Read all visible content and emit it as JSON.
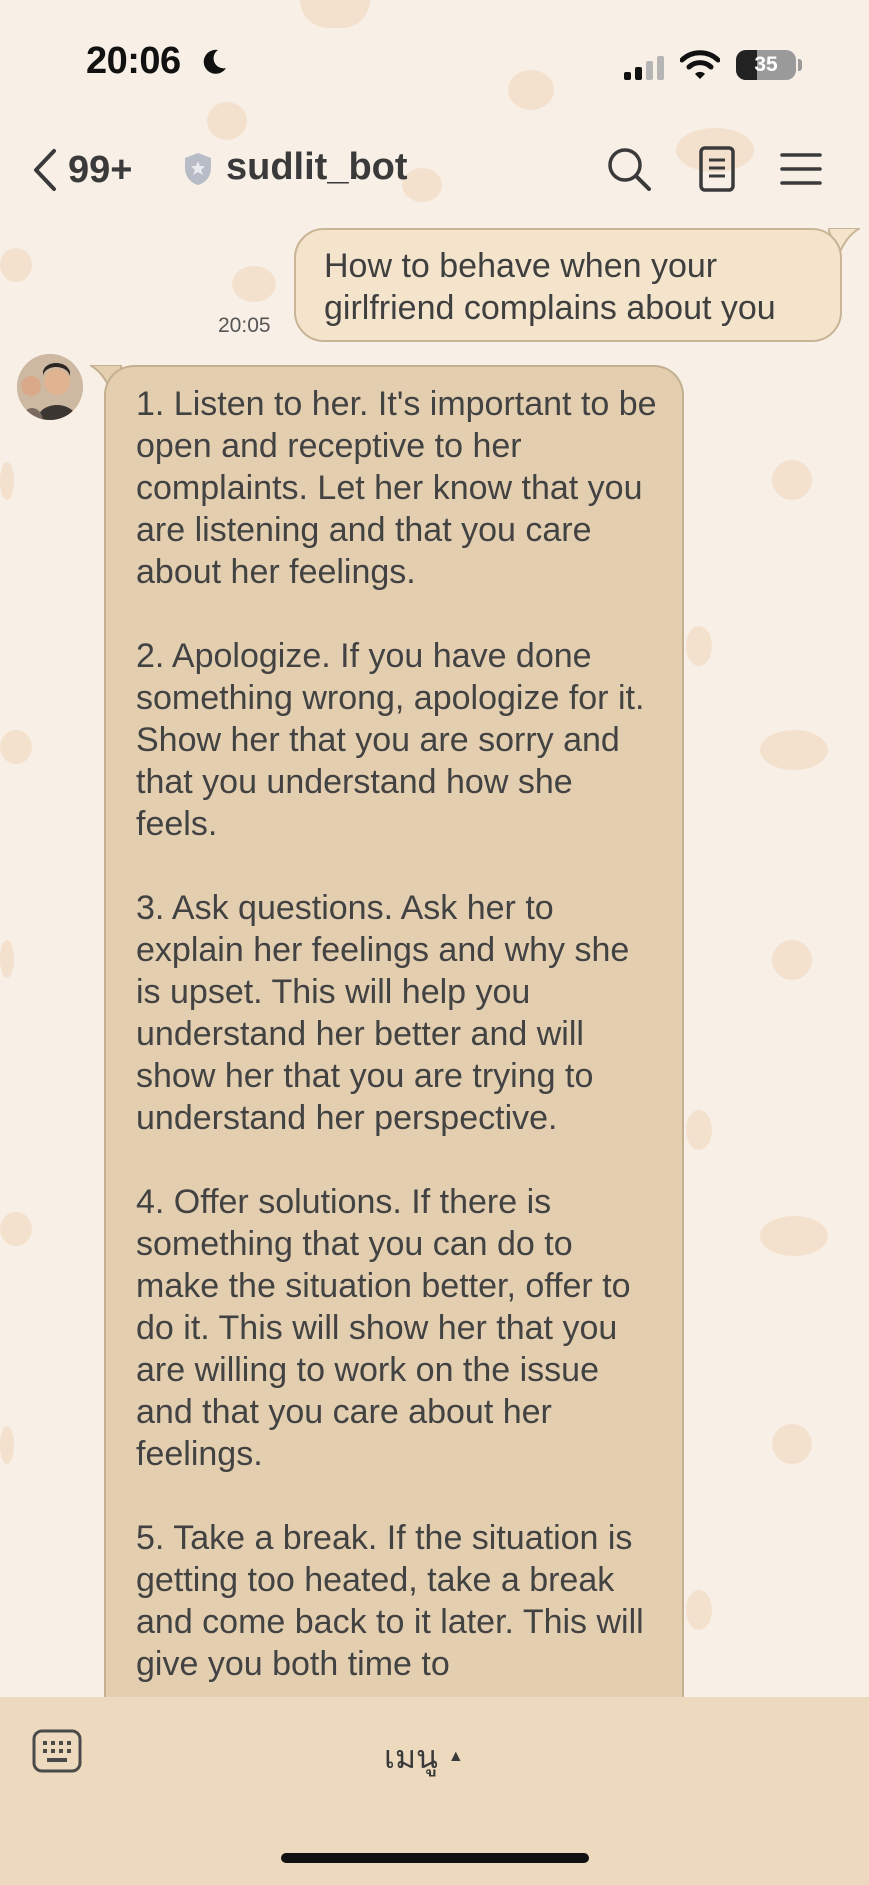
{
  "status_bar": {
    "time": "20:06",
    "battery": "35",
    "battery_level": 0.35
  },
  "header": {
    "back_count": "99+",
    "title": "sudlit_bot"
  },
  "icons": {
    "moon": "moon-icon",
    "signal": "signal-icon",
    "wifi": "wifi-icon",
    "battery": "battery-icon",
    "back": "chevron-left-icon",
    "shield": "shield-icon",
    "search": "search-icon",
    "notes": "document-icon",
    "menu": "hamburger-menu-icon",
    "keyboard": "keyboard-icon",
    "caret": "caret-up-icon"
  },
  "messages": {
    "outgoing": {
      "text": "How to behave when your girlfriend complains about you",
      "time": "20:05"
    },
    "incoming": {
      "paragraphs": [
        "1. Listen to her. It's important to be open and receptive to her complaints. Let her know that you are listening and that you care about her feelings.",
        "2. Apologize. If you have done something wrong, apologize for it. Show her that you are sorry and that you understand how she feels.",
        "3. Ask questions. Ask her to explain her feelings and why she is upset. This will help you understand her better and will show her that you are trying to understand her perspective.",
        "4. Offer solutions. If there is something that you can do to make the situation better, offer to do it. This will show her that you are willing to work on the issue and that you care about her feelings.",
        "5. Take a break. If the situation is getting too heated, take a break and come back to it later. This will give you both time to"
      ]
    }
  },
  "bottom_bar": {
    "menu_label": "เมนู",
    "caret": "▲"
  },
  "colors": {
    "background": "#f8f0e6",
    "outgoing_bubble": "#f4e4cc",
    "incoming_bubble": "#e3cfb0",
    "bubble_border": "#c9b595",
    "bottom_bar": "#eddabe",
    "decor": "#efd9c2"
  }
}
